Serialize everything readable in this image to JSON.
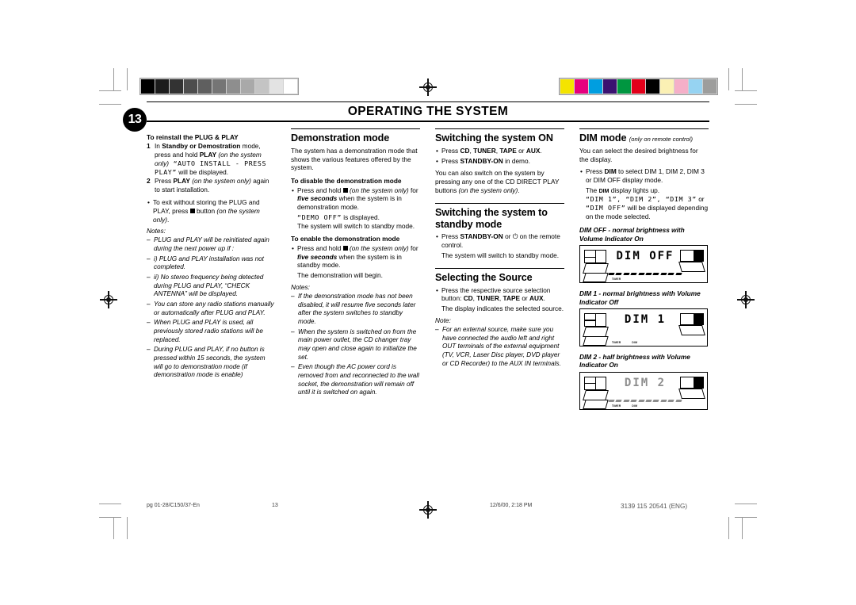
{
  "page": {
    "number": "13",
    "chapter_title": "OPERATING THE SYSTEM"
  },
  "grayscale_bar": [
    "#000000",
    "#1c1c1c",
    "#333333",
    "#4d4d4d",
    "#5f5f5f",
    "#757575",
    "#8e8e8e",
    "#a9a9a9",
    "#c4c4c4",
    "#e3e3e3",
    "#ffffff"
  ],
  "color_bar": [
    "#f4e400",
    "#e6007e",
    "#009ee0",
    "#3b1271",
    "#009640",
    "#e2001a",
    "#000000",
    "#fbf0b4",
    "#f5afc8",
    "#96d3f2",
    "#9d9d9c"
  ],
  "columns": [
    {
      "id": "col-reinstall",
      "heading": "To reinstall the PLUG & PLAY",
      "steps": [
        {
          "num": "1",
          "parts": [
            {
              "t": "In ",
              "s": "plain"
            },
            {
              "t": "Standby or Demostration",
              "s": "bold"
            },
            {
              "t": " mode, press and hold ",
              "s": "plain"
            },
            {
              "t": "PLAY",
              "s": "bold"
            },
            {
              "t": " (on the system only)",
              "s": "italic"
            },
            {
              "t": " “AUTO INSTALL - PRESS PLAY”",
              "s": "lcd"
            },
            {
              "t": " will be displayed.",
              "s": "plain"
            }
          ]
        },
        {
          "num": "2",
          "parts": [
            {
              "t": "Press ",
              "s": "plain"
            },
            {
              "t": "PLAY",
              "s": "bold"
            },
            {
              "t": " (on the system only)",
              "s": "italic"
            },
            {
              "t": " again to start installation.",
              "s": "plain"
            }
          ]
        }
      ],
      "bullets": [
        {
          "parts": [
            {
              "t": "To exit without storing the PLUG and PLAY, press ",
              "s": "plain"
            },
            {
              "t": "■",
              "s": "square"
            },
            {
              "t": " button ",
              "s": "plain"
            },
            {
              "t": "(on the system only)",
              "s": "italic"
            },
            {
              "t": ".",
              "s": "plain"
            }
          ]
        }
      ],
      "notes_label": "Notes:",
      "notes": [
        "PLUG and PLAY will be reinitiated again during the next power up if :",
        "i) PLUG and PLAY installation was not completed.",
        "ii) No stereo frequency being detected during PLUG and PLAY, “CHECK ANTENNA” will be displayed.",
        "You can store any radio stations manually or automatically after PLUG and PLAY.",
        "When PLUG and PLAY is used, all previously stored radio stations will be replaced.",
        "During PLUG and PLAY, if no button is pressed within 15 seconds, the system will go to demonstration mode (if demonstration mode is enable)"
      ]
    },
    {
      "id": "col-demo",
      "heading": "Demonstration mode",
      "intro": "The system has a demonstration mode that shows the various features offered by the system.",
      "sub1_heading": "To disable the demonstration mode",
      "sub1_bullet_parts": [
        {
          "t": "Press and hold ",
          "s": "plain"
        },
        {
          "t": "■",
          "s": "square"
        },
        {
          "t": " (on the system only)",
          "s": "italic"
        },
        {
          "t": " for ",
          "s": "plain"
        },
        {
          "t": "five seconds",
          "s": "bolditalic"
        },
        {
          "t": " when the system is in demonstration mode.",
          "s": "plain"
        }
      ],
      "sub1_result_lcd": "“DEMO OFF”",
      "sub1_result_tail": " is displayed.",
      "sub1_result2": "The system will switch to standby mode.",
      "sub2_heading": "To enable the demonstration mode",
      "sub2_bullet_parts": [
        {
          "t": "Press and hold ",
          "s": "plain"
        },
        {
          "t": "■",
          "s": "square"
        },
        {
          "t": " (on the system only)",
          "s": "italic"
        },
        {
          "t": " for ",
          "s": "plain"
        },
        {
          "t": "five seconds",
          "s": "bolditalic"
        },
        {
          "t": " when the system is in standby mode.",
          "s": "plain"
        }
      ],
      "sub2_result": "The demonstration will begin.",
      "notes_label": "Notes:",
      "notes": [
        "If the demonstration mode has not been disabled, it will resume five seconds later after the system switches to standby mode.",
        "When the system is switched on from the main power outlet, the CD changer tray may open and close again to initialize the set.",
        "Even though the AC power cord is removed from and reconnected to the wall socket, the demonstration will remain off until it is switched on again."
      ]
    },
    {
      "id": "col-switching",
      "heading1": "Switching the system ON",
      "bullets1": [
        {
          "parts": [
            {
              "t": "Press ",
              "s": "plain"
            },
            {
              "t": "CD",
              "s": "bold"
            },
            {
              "t": ", ",
              "s": "plain"
            },
            {
              "t": "TUNER",
              "s": "bold"
            },
            {
              "t": ", ",
              "s": "plain"
            },
            {
              "t": "TAPE",
              "s": "bold"
            },
            {
              "t": " or ",
              "s": "plain"
            },
            {
              "t": "AUX",
              "s": "bold"
            },
            {
              "t": ".",
              "s": "plain"
            }
          ]
        },
        {
          "parts": [
            {
              "t": "Press ",
              "s": "plain"
            },
            {
              "t": "STANDBY-ON",
              "s": "bold"
            },
            {
              "t": " in demo.",
              "s": "plain"
            }
          ]
        }
      ],
      "para1_parts": [
        {
          "t": "You can also switch on the system by pressing any one of the CD DIRECT PLAY buttons ",
          "s": "plain"
        },
        {
          "t": "(on the system only)",
          "s": "italic"
        },
        {
          "t": ".",
          "s": "plain"
        }
      ],
      "heading2": "Switching the system to standby mode",
      "bullets2_parts": [
        {
          "t": "Press ",
          "s": "plain"
        },
        {
          "t": "STANDBY-ON",
          "s": "bold"
        },
        {
          "t": " or ",
          "s": "plain"
        },
        {
          "t": "⏻",
          "s": "power"
        },
        {
          "t": " on the remote control.",
          "s": "plain"
        }
      ],
      "bullets2_result": "The system will switch to standby mode.",
      "heading3": "Selecting the Source",
      "bullets3_parts": [
        {
          "t": "Press the respective source selection button: ",
          "s": "plain"
        },
        {
          "t": "CD",
          "s": "bold"
        },
        {
          "t": ", ",
          "s": "plain"
        },
        {
          "t": "TUNER",
          "s": "bold"
        },
        {
          "t": ", ",
          "s": "plain"
        },
        {
          "t": "TAPE",
          "s": "bold"
        },
        {
          "t": " or ",
          "s": "plain"
        },
        {
          "t": "AUX",
          "s": "bold"
        },
        {
          "t": ".",
          "s": "plain"
        }
      ],
      "bullets3_result": "The display indicates the selected source.",
      "note_label": "Note:",
      "notes": [
        "For an external source, make sure you have connected the audio left and right OUT terminals of the external equipment (TV, VCR, Laser Disc player, DVD player or CD Recorder) to the AUX IN terminals."
      ]
    },
    {
      "id": "col-dim",
      "heading": "DIM mode",
      "heading_sub": "(only on remote control)",
      "intro": "You can select the desired brightness for the display.",
      "bullet_parts": [
        {
          "t": "Press ",
          "s": "plain"
        },
        {
          "t": "DIM",
          "s": "bold"
        },
        {
          "t": " to select DIM 1, DIM 2, DIM 3 or DIM OFF display mode.",
          "s": "plain"
        }
      ],
      "result1_pre": "The ",
      "result1_mid": "DIM",
      "result1_post": " display lights up.",
      "result2_lcd": "“DIM 1”, “DIM 2”, “DIM 3”",
      "result2_tail": " or",
      "result3_lcd": "“DIM OFF”",
      "result3_tail": " will be displayed depending on the mode selected.",
      "displays": [
        {
          "caption": "DIM OFF - normal brightness with Volume Indicator On",
          "lcd_text": "DIM OFF",
          "volume_bar": "on",
          "brightness": "normal",
          "micro_labels": [
            "TIMER"
          ]
        },
        {
          "caption": "DIM 1 - normal brightness with Volume Indicator Off",
          "lcd_text": "DIM 1",
          "volume_bar": "off",
          "brightness": "normal",
          "micro_labels": [
            "TIMER",
            "DIM"
          ]
        },
        {
          "caption": "DIM 2 - half brightness with Volume Indicator On",
          "lcd_text": "DIM 2",
          "volume_bar": "half",
          "brightness": "half",
          "micro_labels": [
            "TIMER",
            "DIM"
          ]
        }
      ]
    }
  ],
  "footer": {
    "file_ref": "pg 01-28/C150/37-En",
    "page_number": "13",
    "timestamp": "12/6/00, 2:18 PM",
    "doc_code": "3139 115 20541 (ENG)"
  }
}
